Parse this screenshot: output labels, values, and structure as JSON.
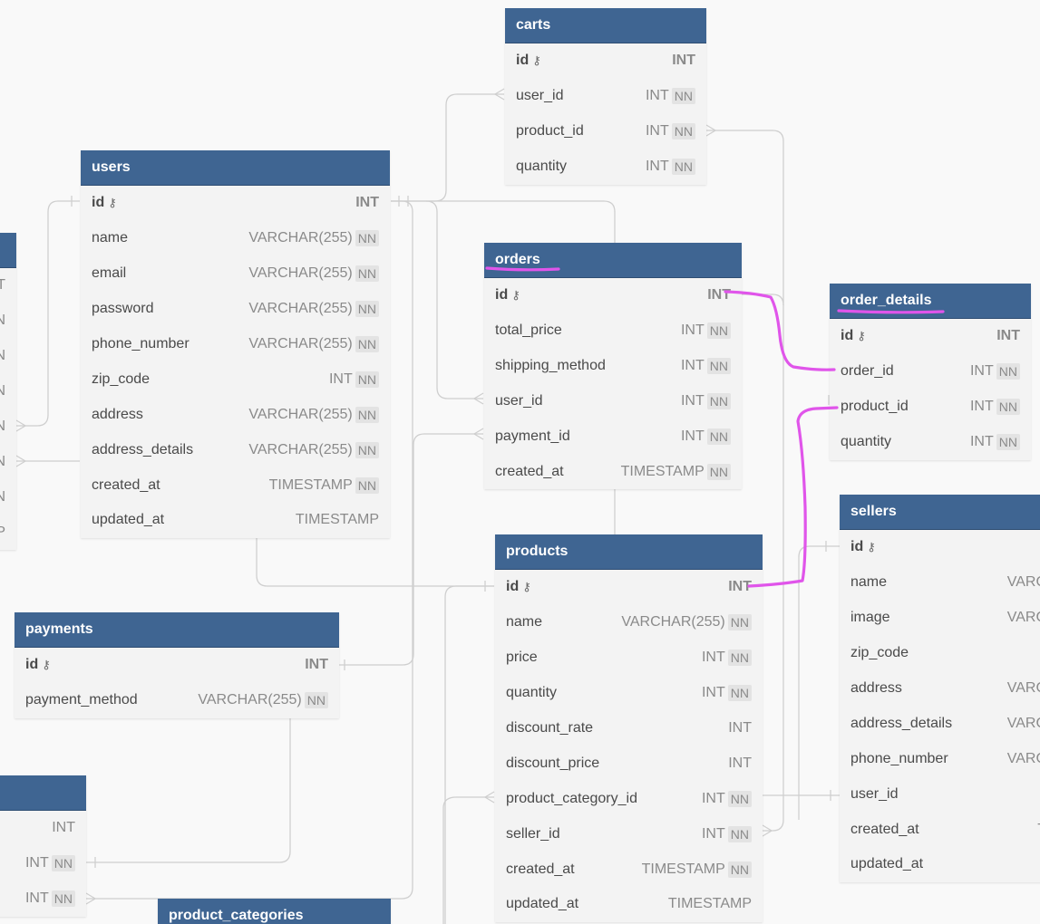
{
  "diagram": {
    "tables": [
      {
        "id": "carts",
        "name": "carts",
        "fields": [
          {
            "name": "id",
            "type": "INT",
            "pk": true
          },
          {
            "name": "user_id",
            "type": "INT",
            "nn": "NN"
          },
          {
            "name": "product_id",
            "type": "INT",
            "nn": "NN"
          },
          {
            "name": "quantity",
            "type": "INT",
            "nn": "NN"
          }
        ]
      },
      {
        "id": "users",
        "name": "users",
        "fields": [
          {
            "name": "id",
            "type": "INT",
            "pk": true
          },
          {
            "name": "name",
            "type": "VARCHAR(255)",
            "nn": "NN"
          },
          {
            "name": "email",
            "type": "VARCHAR(255)",
            "nn": "NN"
          },
          {
            "name": "password",
            "type": "VARCHAR(255)",
            "nn": "NN"
          },
          {
            "name": "phone_number",
            "type": "VARCHAR(255)",
            "nn": "NN"
          },
          {
            "name": "zip_code",
            "type": "INT",
            "nn": "NN"
          },
          {
            "name": "address",
            "type": "VARCHAR(255)",
            "nn": "NN"
          },
          {
            "name": "address_details",
            "type": "VARCHAR(255)",
            "nn": "NN"
          },
          {
            "name": "created_at",
            "type": "TIMESTAMP",
            "nn": "NN"
          },
          {
            "name": "updated_at",
            "type": "TIMESTAMP"
          }
        ]
      },
      {
        "id": "orders",
        "name": "orders",
        "fields": [
          {
            "name": "id",
            "type": "INT",
            "pk": true
          },
          {
            "name": "total_price",
            "type": "INT",
            "nn": "NN"
          },
          {
            "name": "shipping_method",
            "type": "INT",
            "nn": "NN"
          },
          {
            "name": "user_id",
            "type": "INT",
            "nn": "NN"
          },
          {
            "name": "payment_id",
            "type": "INT",
            "nn": "NN"
          },
          {
            "name": "created_at",
            "type": "TIMESTAMP",
            "nn": "NN"
          }
        ]
      },
      {
        "id": "order-details",
        "name": "order_details",
        "fields": [
          {
            "name": "id",
            "type": "INT",
            "pk": true
          },
          {
            "name": "order_id",
            "type": "INT",
            "nn": "NN"
          },
          {
            "name": "product_id",
            "type": "INT",
            "nn": "NN"
          },
          {
            "name": "quantity",
            "type": "INT",
            "nn": "NN"
          }
        ]
      },
      {
        "id": "products",
        "name": "products",
        "fields": [
          {
            "name": "id",
            "type": "INT",
            "pk": true
          },
          {
            "name": "name",
            "type": "VARCHAR(255)",
            "nn": "NN"
          },
          {
            "name": "price",
            "type": "INT",
            "nn": "NN"
          },
          {
            "name": "quantity",
            "type": "INT",
            "nn": "NN"
          },
          {
            "name": "discount_rate",
            "type": "INT"
          },
          {
            "name": "discount_price",
            "type": "INT"
          },
          {
            "name": "product_category_id",
            "type": "INT",
            "nn": "NN"
          },
          {
            "name": "seller_id",
            "type": "INT",
            "nn": "NN"
          },
          {
            "name": "created_at",
            "type": "TIMESTAMP",
            "nn": "NN"
          },
          {
            "name": "updated_at",
            "type": "TIMESTAMP"
          }
        ]
      },
      {
        "id": "sellers",
        "name": "sellers",
        "fields": [
          {
            "name": "id",
            "type": "",
            "pk": true
          },
          {
            "name": "name",
            "type": "VARC"
          },
          {
            "name": "image",
            "type": "VARC"
          },
          {
            "name": "zip_code",
            "type": ""
          },
          {
            "name": "address",
            "type": "VARC"
          },
          {
            "name": "address_details",
            "type": "VARC"
          },
          {
            "name": "phone_number",
            "type": "VARC"
          },
          {
            "name": "user_id",
            "type": ""
          },
          {
            "name": "created_at",
            "type": "T"
          },
          {
            "name": "updated_at",
            "type": ""
          }
        ]
      },
      {
        "id": "payments",
        "name": "payments",
        "fields": [
          {
            "name": "id",
            "type": "INT",
            "pk": true
          },
          {
            "name": "payment_method",
            "type": "VARCHAR(255)",
            "nn": "NN"
          }
        ]
      },
      {
        "id": "left-table-a",
        "name": "",
        "fields": [
          {
            "name": "",
            "type": "T"
          },
          {
            "name": "",
            "type": "N"
          },
          {
            "name": "",
            "type": "N"
          },
          {
            "name": "",
            "type": "N"
          },
          {
            "name": "",
            "type": "N"
          },
          {
            "name": "",
            "type": "N"
          },
          {
            "name": "",
            "type": "N"
          },
          {
            "name": "",
            "type": "P"
          }
        ]
      },
      {
        "id": "left-table-b",
        "name": "",
        "fields": [
          {
            "name": "",
            "type": "INT"
          },
          {
            "name": "",
            "type": "INT",
            "nn": "NN"
          },
          {
            "name": "",
            "type": "INT",
            "nn": "NN"
          }
        ]
      },
      {
        "id": "product-categories",
        "name": "product_categories",
        "fields": []
      }
    ]
  },
  "colors": {
    "header": "#3f6592",
    "table_bg": "#f3f3f3",
    "link": "#cfcfcf",
    "annotation": "#e055ea"
  }
}
